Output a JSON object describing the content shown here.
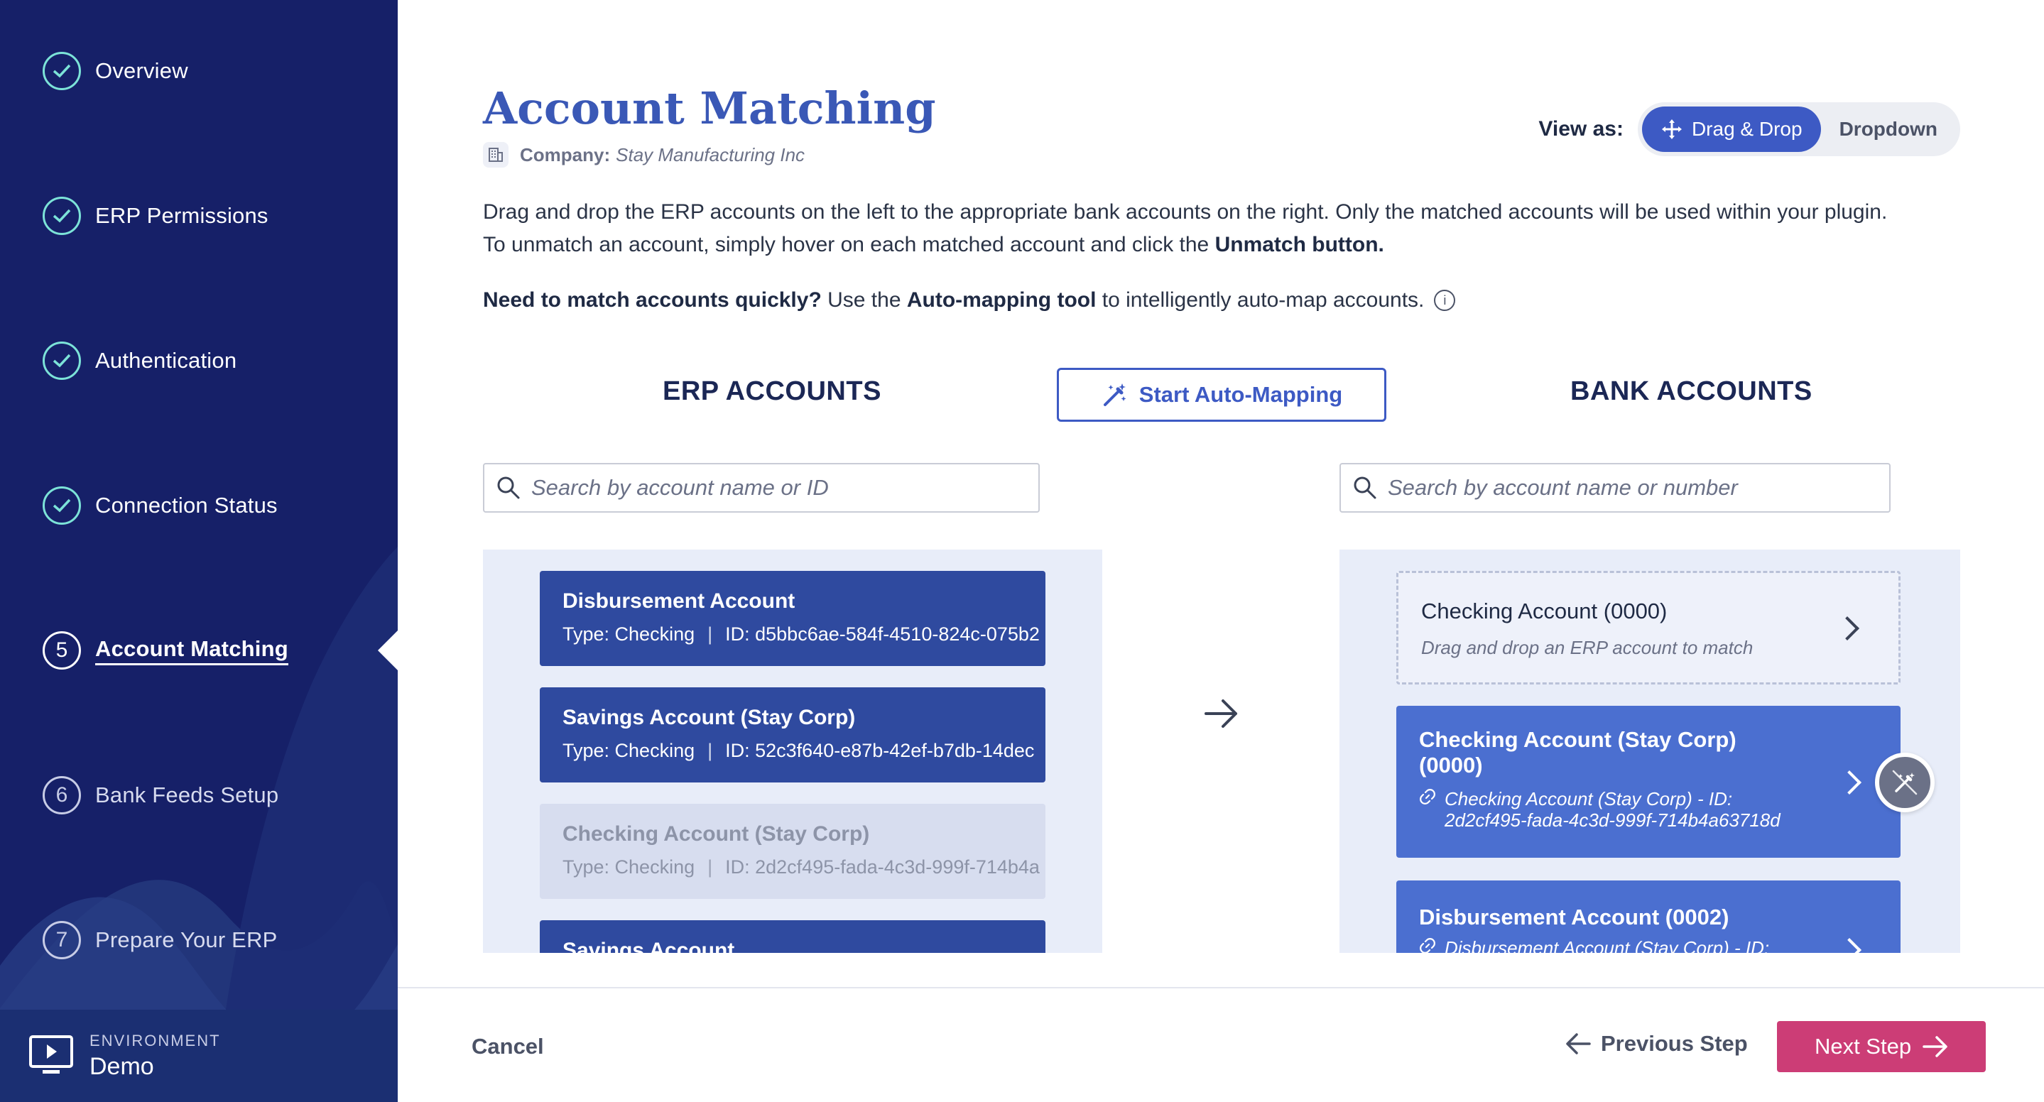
{
  "sidebar": {
    "items": [
      {
        "label": "Overview",
        "state": "done"
      },
      {
        "label": "ERP Permissions",
        "state": "done"
      },
      {
        "label": "Authentication",
        "state": "done"
      },
      {
        "label": "Connection Status",
        "state": "done"
      },
      {
        "label": "Account Matching",
        "number": "5",
        "state": "active"
      },
      {
        "label": "Bank Feeds Setup",
        "number": "6",
        "state": "todo"
      },
      {
        "label": "Prepare Your ERP",
        "number": "7",
        "state": "todo"
      }
    ],
    "environment": {
      "caption": "ENVIRONMENT",
      "value": "Demo"
    }
  },
  "header": {
    "title": "Account Matching",
    "company_label": "Company:",
    "company_name": "Stay Manufacturing Inc",
    "view_as_label": "View as:",
    "view_options": [
      "Drag & Drop",
      "Dropdown"
    ],
    "view_selected": "Drag & Drop"
  },
  "instructions": {
    "line1": "Drag and drop the ERP accounts on the left to the appropriate bank accounts on the right. Only the matched accounts will be used within your plugin.",
    "line2_prefix": "To unmatch an account, simply hover on each matched account and click the ",
    "line2_bold": "Unmatch button.",
    "hint_bold1": "Need to match accounts quickly?",
    "hint_mid": " Use the ",
    "hint_bold2": "Auto-mapping tool",
    "hint_end": " to intelligently auto-map accounts.",
    "info_icon": "i"
  },
  "erp": {
    "title": "ERP ACCOUNTS",
    "search_placeholder": "Search by account name or ID",
    "accounts": [
      {
        "name": "Disbursement Account",
        "type": "Type: Checking",
        "id": "ID: d5bbc6ae-584f-4510-824c-075b2",
        "matched": false
      },
      {
        "name": "Savings Account (Stay Corp)",
        "type": "Type: Checking",
        "id": "ID: 52c3f640-e87b-42ef-b7db-14dec",
        "matched": false
      },
      {
        "name": "Checking Account (Stay Corp)",
        "type": "Type: Checking",
        "id": "ID: 2d2cf495-fada-4c3d-999f-714b4a",
        "matched": true
      },
      {
        "name": "Savings Account",
        "type": "",
        "id": "",
        "matched": false
      }
    ]
  },
  "auto_mapping": {
    "label": "Start Auto-Mapping"
  },
  "bank": {
    "title": "BANK ACCOUNTS",
    "search_placeholder": "Search by account name or number",
    "accounts": [
      {
        "name": "Checking Account (0000)",
        "sub": "Drag and drop an ERP account to match"
      },
      {
        "name_line1": "Checking Account (Stay Corp)",
        "name_line2": "(0000)",
        "sub_line1": "Checking Account (Stay Corp) - ID:",
        "sub_line2": "2d2cf495-fada-4c3d-999f-714b4a63718d"
      },
      {
        "name": "Disbursement Account (0002)",
        "sub": "Disbursement Account (Stay Corp) - ID:"
      }
    ]
  },
  "footer": {
    "cancel": "Cancel",
    "previous": "Previous Step",
    "next": "Next Step"
  },
  "colors": {
    "sidebar_bg": "#162068",
    "primary": "#3d5ac4",
    "erp_card": "#2f4a9f",
    "bank_matched": "#4b6fd0",
    "next_button": "#cc3d76",
    "check": "#7ce3d8"
  }
}
